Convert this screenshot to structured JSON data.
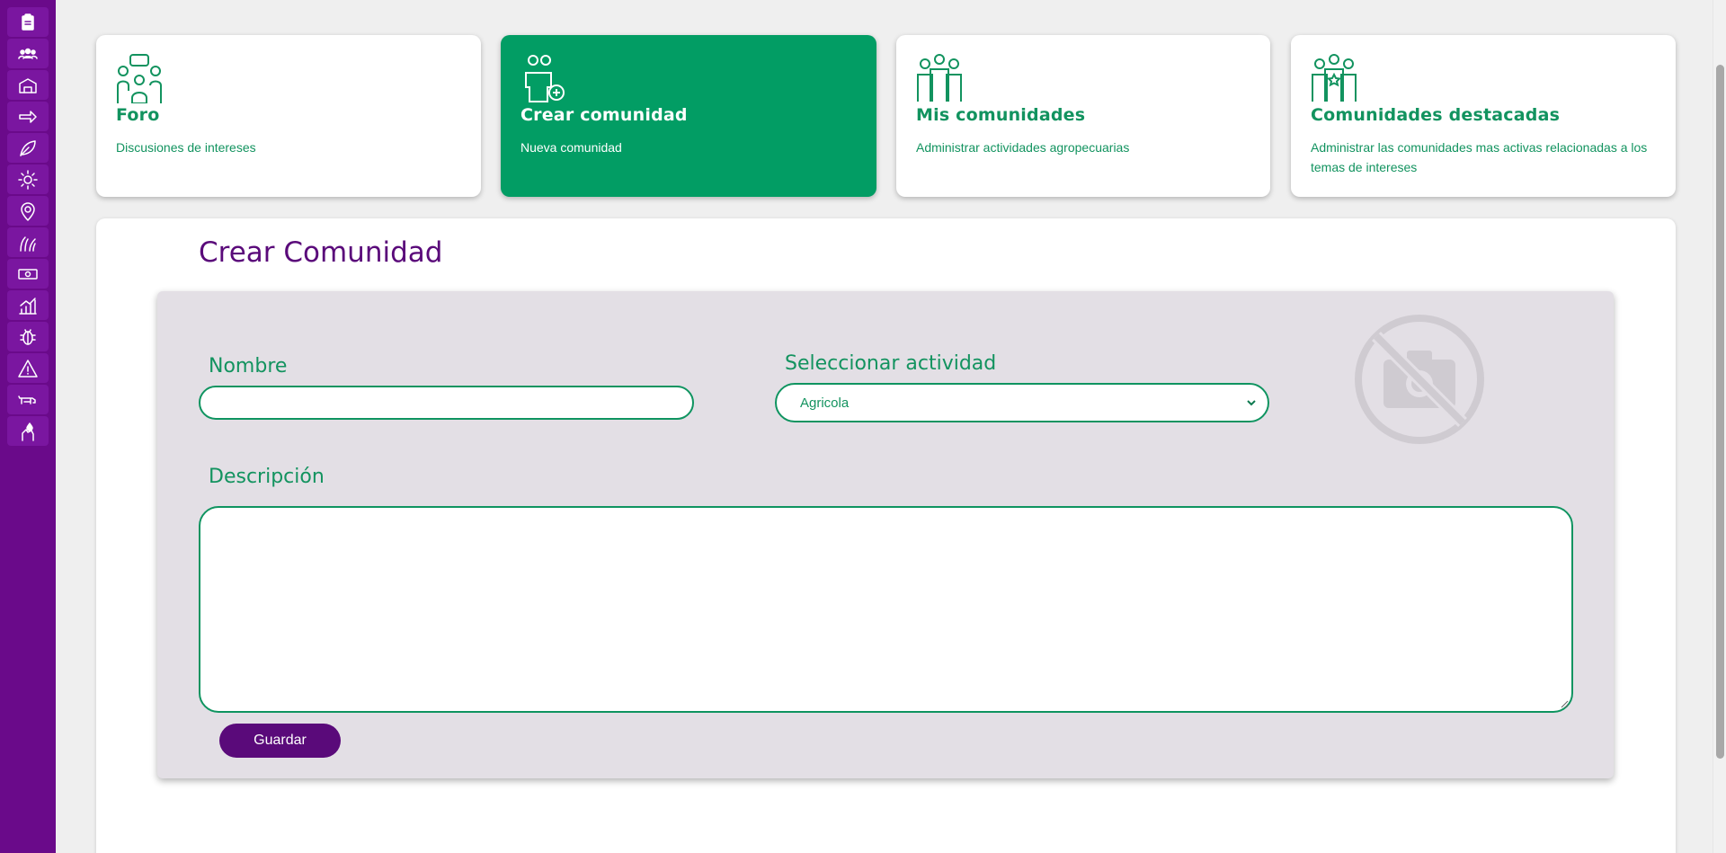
{
  "sidebar": {
    "items": [
      {
        "icon": "clipboard-icon"
      },
      {
        "icon": "users-icon"
      },
      {
        "icon": "barn-icon"
      },
      {
        "icon": "arrow-right-icon"
      },
      {
        "icon": "leaf-icon"
      },
      {
        "icon": "sun-icon"
      },
      {
        "icon": "location-pin-icon"
      },
      {
        "icon": "grass-icon"
      },
      {
        "icon": "money-icon"
      },
      {
        "icon": "chart-icon"
      },
      {
        "icon": "bug-icon"
      },
      {
        "icon": "warning-icon"
      },
      {
        "icon": "animal-icon"
      },
      {
        "icon": "hand-drop-icon"
      }
    ]
  },
  "cards": [
    {
      "title": "Foro",
      "subtitle": "Discusiones de intereses",
      "icon": "forum-people-icon"
    },
    {
      "title": "Crear comunidad",
      "subtitle": "Nueva comunidad",
      "icon": "add-person-icon"
    },
    {
      "title": "Mis comunidades",
      "subtitle": "Administrar actividades agropecuarias",
      "icon": "group-icon"
    },
    {
      "title": "Comunidades destacadas",
      "subtitle": "Administrar las comunidades mas activas relacionadas a los temas de intereses",
      "icon": "star-group-icon"
    }
  ],
  "page": {
    "title": "Crear Comunidad"
  },
  "form": {
    "nombre_label": "Nombre",
    "nombre_value": "",
    "actividad_label": "Seleccionar actividad",
    "actividad_value": "Agricola",
    "descripcion_label": "Descripción",
    "descripcion_value": "",
    "save_label": "Guardar",
    "photo_icon": "no-photo-icon"
  },
  "colors": {
    "sidebar": "#6a0a8a",
    "accent_green": "#029d64",
    "title_purple": "#5a0a7a",
    "form_bg": "#e3dfe5"
  }
}
